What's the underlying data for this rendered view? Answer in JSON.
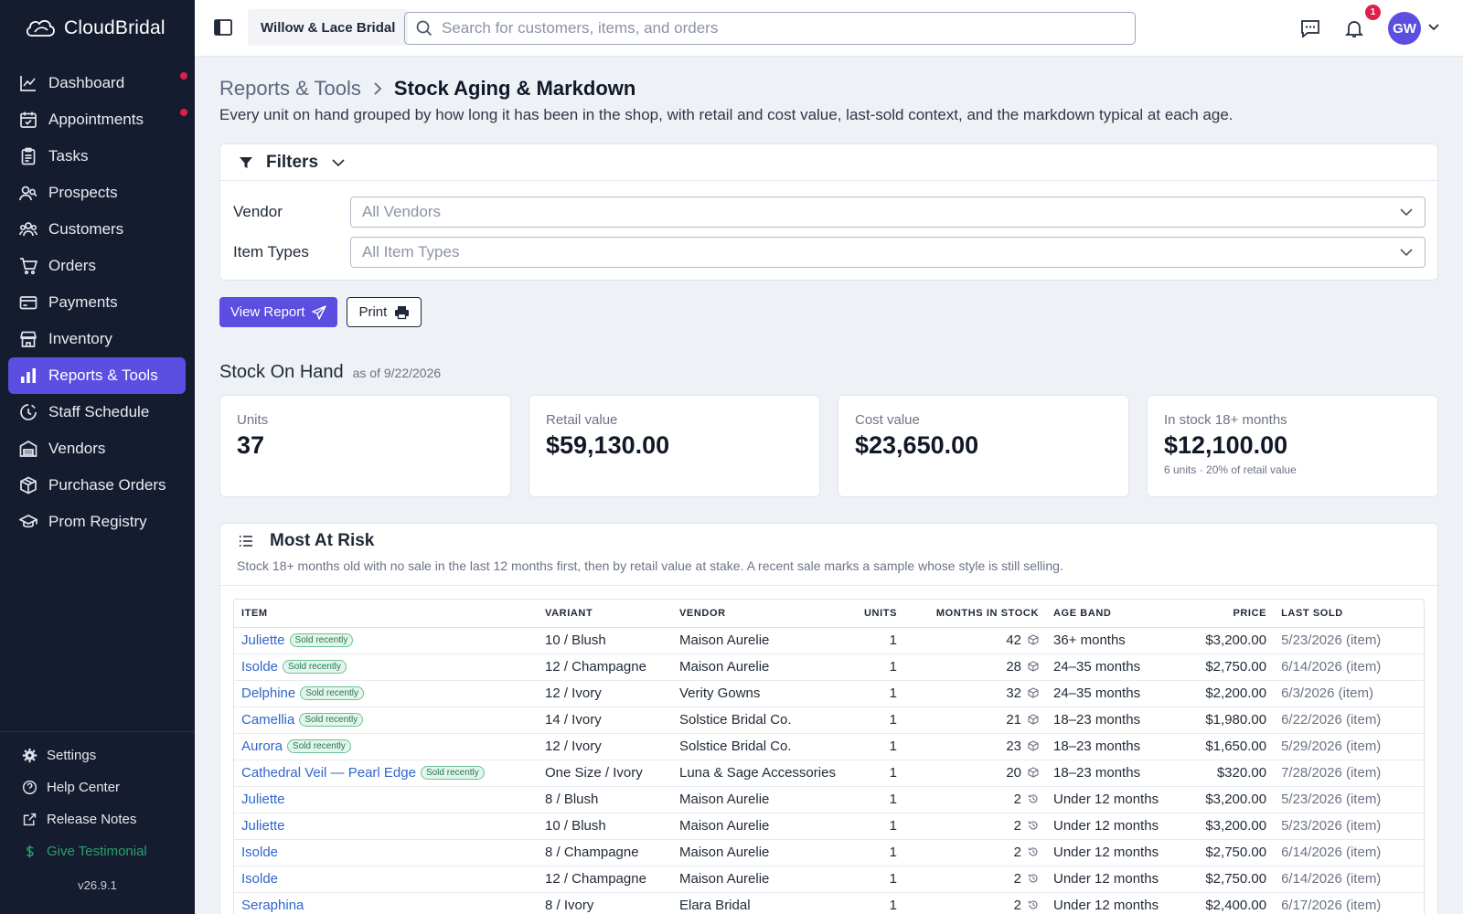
{
  "app": {
    "name": "CloudBridal",
    "version": "v26.9.1"
  },
  "sidebar": {
    "items": [
      {
        "label": "Dashboard",
        "icon": "chart-line-icon",
        "dot": true
      },
      {
        "label": "Appointments",
        "icon": "calendar-icon",
        "dot": true
      },
      {
        "label": "Tasks",
        "icon": "clipboard-icon",
        "dot": false
      },
      {
        "label": "Prospects",
        "icon": "people-search-icon",
        "dot": false
      },
      {
        "label": "Customers",
        "icon": "users-icon",
        "dot": false
      },
      {
        "label": "Orders",
        "icon": "cart-icon",
        "dot": false
      },
      {
        "label": "Payments",
        "icon": "credit-card-icon",
        "dot": false
      },
      {
        "label": "Inventory",
        "icon": "store-icon",
        "dot": false
      },
      {
        "label": "Reports & Tools",
        "icon": "bar-chart-icon",
        "dot": false,
        "active": true
      },
      {
        "label": "Staff Schedule",
        "icon": "clock-icon",
        "dot": false
      },
      {
        "label": "Vendors",
        "icon": "warehouse-icon",
        "dot": false
      },
      {
        "label": "Purchase Orders",
        "icon": "box-icon",
        "dot": false
      },
      {
        "label": "Prom Registry",
        "icon": "graduation-cap-icon",
        "dot": false
      }
    ],
    "bottom": {
      "settings": "Settings",
      "help": "Help Center",
      "release": "Release Notes",
      "testimonial": "Give Testimonial"
    }
  },
  "topbar": {
    "store": "Willow & Lace Bridal",
    "search_placeholder": "Search for customers, items, and orders",
    "notifications_count": "1",
    "avatar_initials": "GW"
  },
  "page": {
    "breadcrumb_parent": "Reports & Tools",
    "breadcrumb_current": "Stock Aging & Markdown",
    "subtitle": "Every unit on hand grouped by how long it has been in the shop, with retail and cost value, last-sold context, and the markdown typical at each age."
  },
  "filters": {
    "title": "Filters",
    "vendor_label": "Vendor",
    "vendor_value": "All Vendors",
    "item_types_label": "Item Types",
    "item_types_value": "All Item Types"
  },
  "actions": {
    "view_report": "View Report",
    "print": "Print"
  },
  "stock_on_hand": {
    "title": "Stock On Hand",
    "as_of": "as of 9/22/2026",
    "stats": [
      {
        "label": "Units",
        "value": "37",
        "note": ""
      },
      {
        "label": "Retail value",
        "value": "$59,130.00",
        "note": ""
      },
      {
        "label": "Cost value",
        "value": "$23,650.00",
        "note": ""
      },
      {
        "label": "In stock 18+ months",
        "value": "$12,100.00",
        "note": "6 units · 20% of retail value"
      }
    ]
  },
  "risk": {
    "title": "Most At Risk",
    "description": "Stock 18+ months old with no sale in the last 12 months first, then by retail value at stake. A recent sale marks a sample whose style is still selling.",
    "columns": {
      "item": "ITEM",
      "variant": "VARIANT",
      "vendor": "VENDOR",
      "units": "UNITS",
      "months": "MONTHS IN STOCK",
      "age_band": "AGE BAND",
      "price": "PRICE",
      "last_sold": "LAST SOLD"
    },
    "sold_recently_label": "Sold recently",
    "rows": [
      {
        "item": "Juliette",
        "sold": true,
        "variant": "10 / Blush",
        "vendor": "Maison Aurelie",
        "units": "1",
        "months": "42",
        "months_icon": "box-icon",
        "age_band": "36+ months",
        "price": "$3,200.00",
        "last_sold": "5/23/2026 (item)"
      },
      {
        "item": "Isolde",
        "sold": true,
        "variant": "12 / Champagne",
        "vendor": "Maison Aurelie",
        "units": "1",
        "months": "28",
        "months_icon": "box-icon",
        "age_band": "24–35 months",
        "price": "$2,750.00",
        "last_sold": "6/14/2026 (item)"
      },
      {
        "item": "Delphine",
        "sold": true,
        "variant": "12 / Ivory",
        "vendor": "Verity Gowns",
        "units": "1",
        "months": "32",
        "months_icon": "box-icon",
        "age_band": "24–35 months",
        "price": "$2,200.00",
        "last_sold": "6/3/2026 (item)"
      },
      {
        "item": "Camellia",
        "sold": true,
        "variant": "14 / Ivory",
        "vendor": "Solstice Bridal Co.",
        "units": "1",
        "months": "21",
        "months_icon": "box-icon",
        "age_band": "18–23 months",
        "price": "$1,980.00",
        "last_sold": "6/22/2026 (item)"
      },
      {
        "item": "Aurora",
        "sold": true,
        "variant": "12 / Ivory",
        "vendor": "Solstice Bridal Co.",
        "units": "1",
        "months": "23",
        "months_icon": "box-icon",
        "age_band": "18–23 months",
        "price": "$1,650.00",
        "last_sold": "5/29/2026 (item)"
      },
      {
        "item": "Cathedral Veil — Pearl Edge",
        "sold": true,
        "variant": "One Size / Ivory",
        "vendor": "Luna & Sage Accessories",
        "units": "1",
        "months": "20",
        "months_icon": "box-icon",
        "age_band": "18–23 months",
        "price": "$320.00",
        "last_sold": "7/28/2026 (item)"
      },
      {
        "item": "Juliette",
        "sold": false,
        "variant": "8 / Blush",
        "vendor": "Maison Aurelie",
        "units": "1",
        "months": "2",
        "months_icon": "history-icon",
        "age_band": "Under 12 months",
        "price": "$3,200.00",
        "last_sold": "5/23/2026 (item)"
      },
      {
        "item": "Juliette",
        "sold": false,
        "variant": "10 / Blush",
        "vendor": "Maison Aurelie",
        "units": "1",
        "months": "2",
        "months_icon": "history-icon",
        "age_band": "Under 12 months",
        "price": "$3,200.00",
        "last_sold": "5/23/2026 (item)"
      },
      {
        "item": "Isolde",
        "sold": false,
        "variant": "8 / Champagne",
        "vendor": "Maison Aurelie",
        "units": "1",
        "months": "2",
        "months_icon": "history-icon",
        "age_band": "Under 12 months",
        "price": "$2,750.00",
        "last_sold": "6/14/2026 (item)"
      },
      {
        "item": "Isolde",
        "sold": false,
        "variant": "12 / Champagne",
        "vendor": "Maison Aurelie",
        "units": "1",
        "months": "2",
        "months_icon": "history-icon",
        "age_band": "Under 12 months",
        "price": "$2,750.00",
        "last_sold": "6/14/2026 (item)"
      },
      {
        "item": "Seraphina",
        "sold": false,
        "variant": "8 / Ivory",
        "vendor": "Elara Bridal",
        "units": "1",
        "months": "2",
        "months_icon": "history-icon",
        "age_band": "Under 12 months",
        "price": "$2,400.00",
        "last_sold": "6/17/2026 (item)"
      }
    ]
  },
  "colors": {
    "sidebar_bg": "#161c2f",
    "accent": "#5b4ee0",
    "link": "#2f66c8",
    "dot": "#e01e4a",
    "success": "#2aa06b"
  }
}
